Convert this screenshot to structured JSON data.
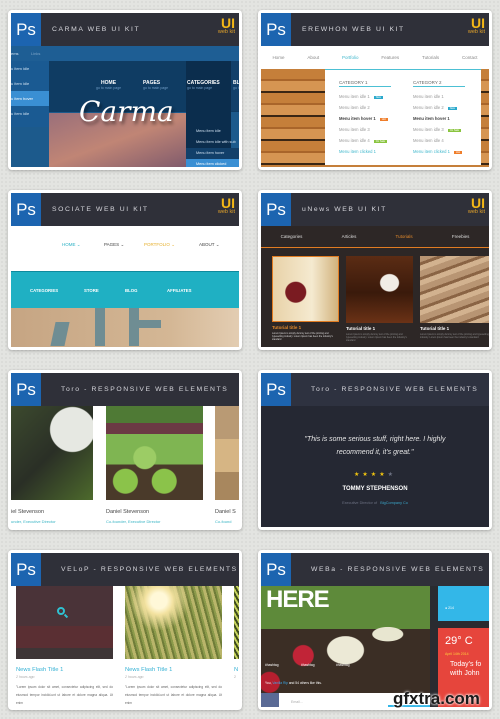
{
  "cards": [
    {
      "ps": "Ps",
      "title": "CARMA WEB UI KIT",
      "ui": "UI",
      "ui_sub": "web kit",
      "topnav": [
        "ems",
        "Links"
      ],
      "left_menu": [
        "u item idle",
        "u item idle",
        "u item hover",
        "u item idle"
      ],
      "nav": [
        {
          "label": "HOME",
          "sub": "go to main page"
        },
        {
          "label": "PAGES",
          "sub": "go to main page"
        },
        {
          "label": "CATEGORIES",
          "sub": "go to main page"
        },
        {
          "label": "BLO",
          "sub": "go to"
        }
      ],
      "logo": "Carma",
      "dropdown": [
        "Menu item idle",
        "Menu item idle with sub",
        "Menu item hover",
        "Menu item clicked"
      ]
    },
    {
      "ps": "Ps",
      "title": "EREWHON WEB UI KIT",
      "ui": "UI",
      "ui_sub": "web kit",
      "nav": [
        "Home",
        "About",
        "Portfolio",
        "Features",
        "Tutorials",
        "Contact"
      ],
      "columns": [
        {
          "heading": "CATEGORY 1",
          "items": [
            {
              "label": "Menu item idle 1",
              "badge": "New"
            },
            {
              "label": "Menu item idle 2"
            },
            {
              "label": "Menu item hover 1",
              "badge": "Hot"
            },
            {
              "label": "Menu item idle 3"
            },
            {
              "label": "Menu item idle 4",
              "badge": "On Sale"
            },
            {
              "label": "Menu item clicked 1"
            }
          ]
        },
        {
          "heading": "CATEGORY 2",
          "items": [
            {
              "label": "Menu item idle 1"
            },
            {
              "label": "Menu item idle 2",
              "badge": "New"
            },
            {
              "label": "Menu item hover 1"
            },
            {
              "label": "Menu item idle 3",
              "badge": "On Sale"
            },
            {
              "label": "Menu item idle 4"
            },
            {
              "label": "Menu item clicked 1",
              "badge": "Hot"
            }
          ]
        }
      ]
    },
    {
      "ps": "Ps",
      "title": "SOCIATE WEB UI KIT",
      "ui": "UI",
      "ui_sub": "web kit",
      "nav": [
        "HOME",
        "PAGES",
        "PORTFOLIO",
        "ABOUT"
      ],
      "subnav": [
        "CATEGORIES",
        "STORE",
        "BLOG",
        "AFFILIATES"
      ]
    },
    {
      "ps": "Ps",
      "title": "uNews WEB UI KIT",
      "ui": "UI",
      "ui_sub": "web kit",
      "nav": [
        "Categories",
        "Articles",
        "Tutorials",
        "Freebies"
      ],
      "posts": [
        {
          "title": "Tutorial title 1",
          "text": "Lorem Ipsum is simply dummy text of the printing and typesetting industry. Lorem Ipsum has been the industry's standard"
        },
        {
          "title": "Tutorial title 1",
          "text": "Lorem Ipsum is simply dummy text of the printing and typesetting industry. Lorem Ipsum has been the industry's standard"
        },
        {
          "title": "Tutorial title 1",
          "text": "Lorem Ipsum is simply dummy text of the printing and typesetting industry. Lorem Ipsum has been the industry's standard"
        }
      ]
    },
    {
      "ps": "Ps",
      "title": "Toro - RESPONSIVE WEB ELEMENTS",
      "people": [
        {
          "name": "iel Stevenson",
          "role": "under, Executive Director"
        },
        {
          "name": "Daniel Stevenson",
          "role": "Co-founder, Executive Director"
        },
        {
          "name": "Daniel S",
          "role": "Co-found"
        }
      ]
    },
    {
      "ps": "Ps",
      "title": "Toro - RESPONSIVE WEB ELEMENTS",
      "quote_line1": "\"This is some serious stuff, right here. I highly",
      "quote_line2": "recommend it, it's great.\"",
      "rating": 4,
      "rating_max": 5,
      "name": "TOMMY STEPHENSON",
      "role_prefix": "Executive Director of",
      "company": "BigCompany Co"
    },
    {
      "ps": "Ps",
      "title": "VELoP - RESPONSIVE WEB ELEMENTS",
      "news": [
        {
          "title": "News Flash Title 1",
          "time": "2 hours ago",
          "text": "\"Lorem ipsum dolor sit amet, consectetur adipiscing elit, sed do eiusmod tempor incidid-unt ut labore et dolore magna aliqua. Ut enim"
        },
        {
          "title": "News Flash Title 1",
          "time": "2 hours ago",
          "text": "\"Lorem ipsum dolor sit amet, consectetur adipiscing elit, sed do eiusmod tempor incidid-unt ut labore et dolore magna aliqua. Ut enim"
        },
        {
          "title": "N",
          "time": "2",
          "text": "\"L ad un"
        }
      ]
    },
    {
      "ps": "Ps",
      "title": "WEBa - RESPONSIVE WEB ELEMENTS",
      "hero_text": "HERE",
      "hashtags": [
        "#hashtag",
        "#hashtag",
        "#hashtag"
      ],
      "likes_prefix": "You,",
      "likes_user": "Vanilla Rip",
      "likes_suffix": "and 54 others like this.",
      "comment_count": "214",
      "temp": "29° C",
      "date": "April 14th 2014",
      "today1": "Today's fo",
      "today2": "with John",
      "email_placeholder": "Email..."
    }
  ],
  "watermark": "gfxtra.com"
}
